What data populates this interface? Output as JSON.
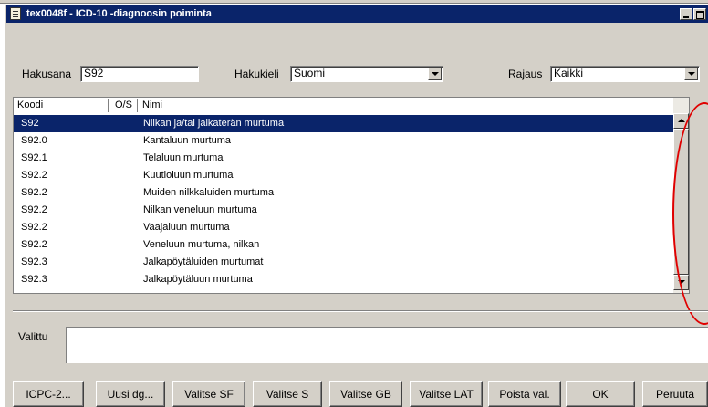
{
  "window": {
    "title": "tex0048f - ICD-10 -diagnoosin poiminta"
  },
  "search": {
    "hakusana_label": "Hakusana",
    "hakusana_value": "S92",
    "hakukieli_label": "Hakukieli",
    "hakukieli_value": "Suomi",
    "rajaus_label": "Rajaus",
    "rajaus_value": "Kaikki"
  },
  "table": {
    "headers": {
      "code": "Koodi",
      "os": "O/S",
      "name": "Nimi"
    },
    "rows": [
      {
        "code": "S92",
        "name": "Nilkan ja/tai jalkaterän murtuma",
        "selected": true
      },
      {
        "code": "S92.0",
        "name": "Kantaluun murtuma"
      },
      {
        "code": "S92.1",
        "name": "Telaluun murtuma"
      },
      {
        "code": "S92.2",
        "name": "Kuutioluun murtuma"
      },
      {
        "code": "S92.2",
        "name": "Muiden nilkkaluiden murtuma"
      },
      {
        "code": "S92.2",
        "name": "Nilkan veneluun murtuma"
      },
      {
        "code": "S92.2",
        "name": "Vaajaluun murtuma"
      },
      {
        "code": "S92.2",
        "name": "Veneluun murtuma, nilkan"
      },
      {
        "code": "S92.3",
        "name": "Jalkapöytäluiden murtumat"
      },
      {
        "code": "S92.3",
        "name": "Jalkapöytäluun murtuma"
      }
    ]
  },
  "selected": {
    "label": "Valittu",
    "value": ""
  },
  "buttons": {
    "icpc": "ICPC-2...",
    "uusi": "Uusi dg...",
    "valitse_sf": "Valitse SF",
    "valitse_s": "Valitse S",
    "valitse_gb": "Valitse GB",
    "valitse_lat": "Valitse LAT",
    "poista": "Poista val.",
    "ok": "OK",
    "peruuta": "Peruuta"
  },
  "colors": {
    "titlebar": "#0a246a",
    "selection": "#0a246a",
    "face": "#d4d0c8",
    "annotation": "#e00000"
  },
  "icons": [
    "document-icon",
    "minimize-icon",
    "maximize-icon",
    "chevron-down-icon",
    "arrow-up-icon",
    "arrow-down-icon"
  ]
}
